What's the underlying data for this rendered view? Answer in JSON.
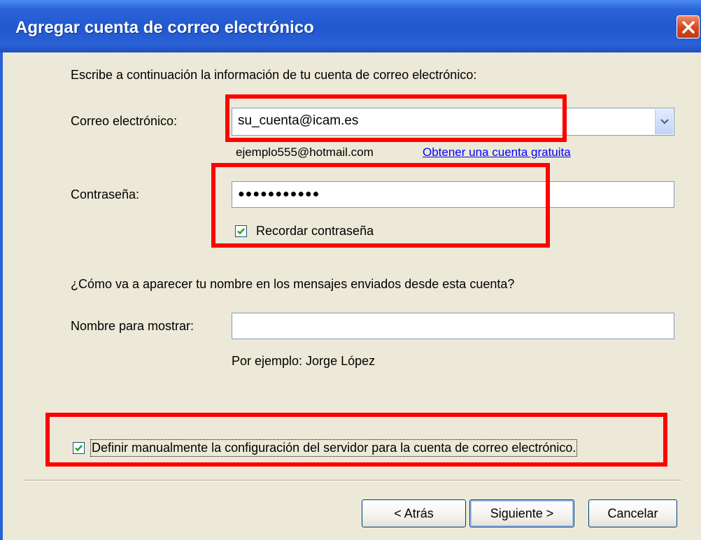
{
  "window": {
    "title": "Agregar cuenta de correo electrónico"
  },
  "intro": "Escribe a continuación la información de tu cuenta de correo electrónico:",
  "email": {
    "label": "Correo electrónico:",
    "value": "su_cuenta@icam.es",
    "example": "ejemplo555@hotmail.com",
    "link": "Obtener una cuenta gratuita"
  },
  "password": {
    "label": "Contraseña:",
    "value": "●●●●●●●●●●●",
    "remember_label": "Recordar contraseña",
    "remember_checked": true
  },
  "display_name": {
    "question": "¿Cómo va a aparecer tu nombre en los mensajes enviados desde esta cuenta?",
    "label": "Nombre para mostrar:",
    "value": "",
    "example": "Por ejemplo: Jorge López"
  },
  "manual_config": {
    "label": "Definir manualmente la configuración del servidor para la cuenta de correo electrónico.",
    "checked": true
  },
  "buttons": {
    "back": "< Atrás",
    "next": "Siguiente >",
    "cancel": "Cancelar"
  },
  "colors": {
    "titlebar": "#2157cf",
    "dialog_bg": "#ece9d8",
    "highlight": "#ff0000",
    "link": "#0000ff"
  }
}
